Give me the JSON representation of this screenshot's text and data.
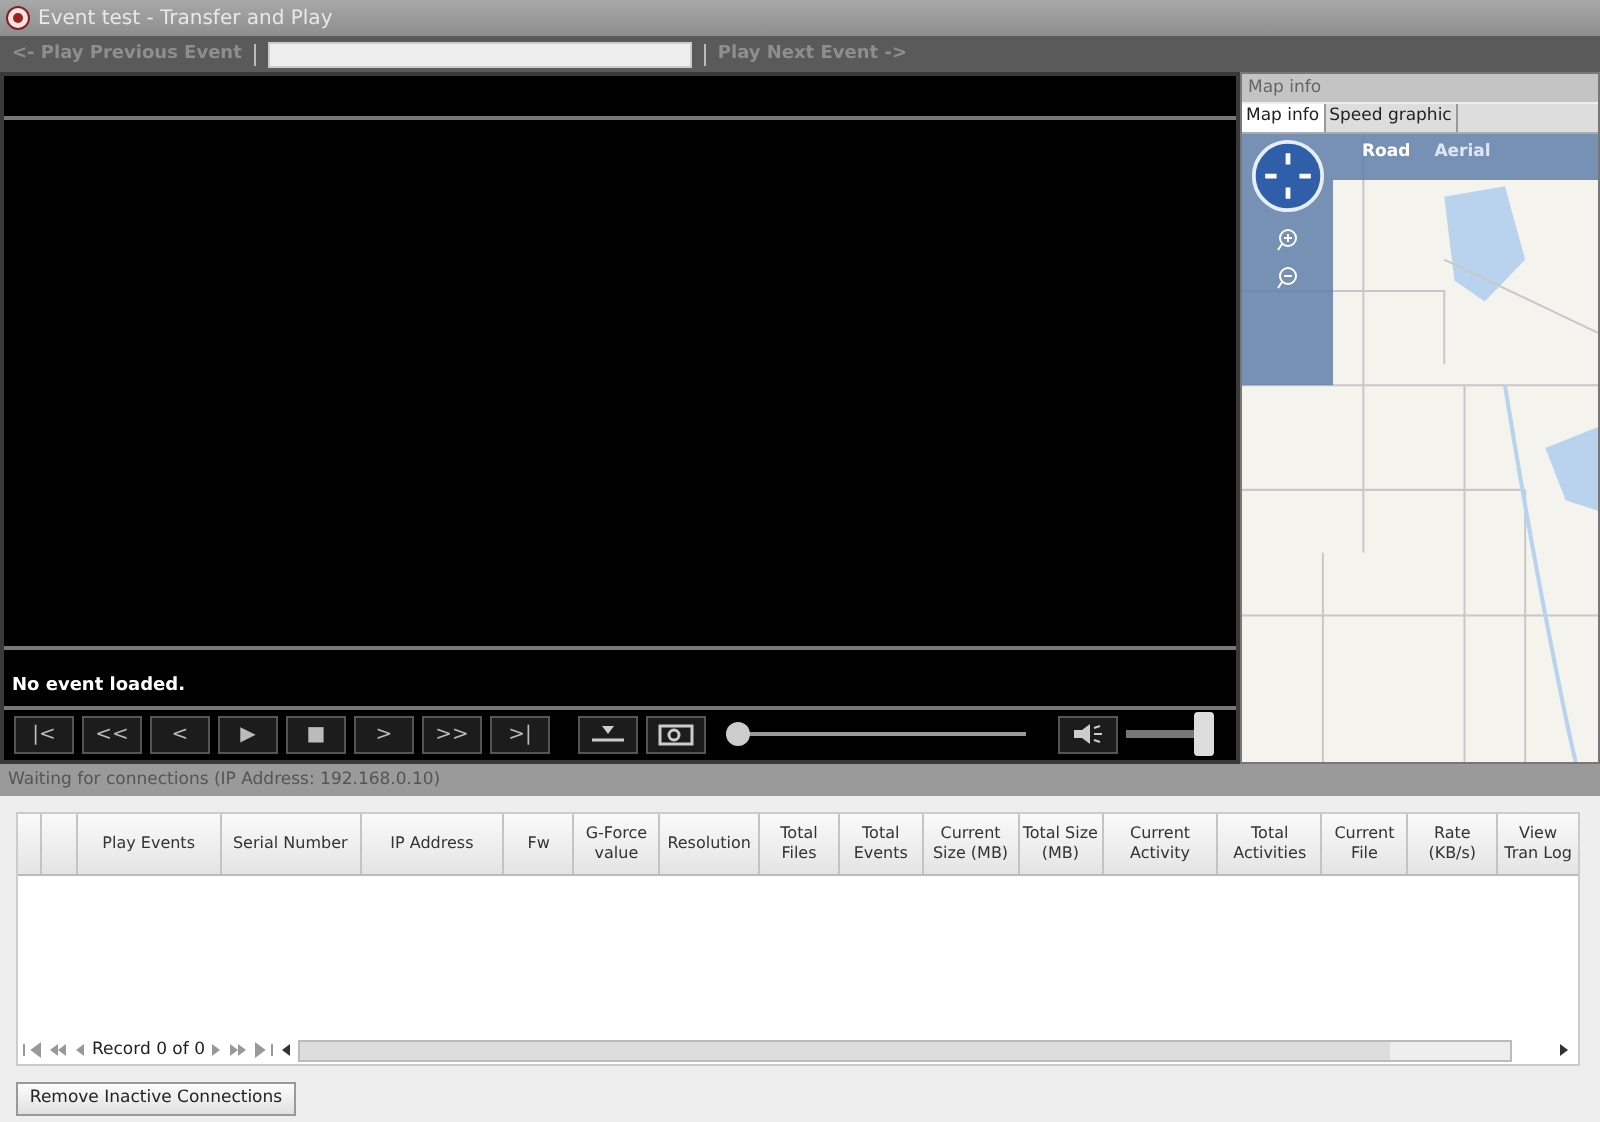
{
  "window": {
    "title": "Event test - Transfer and Play"
  },
  "event_nav": {
    "previous": "<- Play Previous Event",
    "next": "Play Next Event ->"
  },
  "player": {
    "status": "No event loaded.",
    "controls": [
      {
        "label": "|<"
      },
      {
        "label": "<<"
      },
      {
        "label": "<"
      },
      {
        "label": "▶"
      },
      {
        "label": "■"
      },
      {
        "label": ">"
      },
      {
        "label": ">>"
      },
      {
        "label": ">|"
      }
    ],
    "position": {
      "level": 0
    },
    "volume": {
      "level": 1
    }
  },
  "map_panel": {
    "title": "Map info",
    "tabs": [
      {
        "label": "Map info",
        "selected": true
      },
      {
        "label": "Speed graphic",
        "selected": false
      }
    ],
    "map_modes": [
      {
        "label": "Road",
        "selected": true
      },
      {
        "label": "Aerial",
        "selected": false
      }
    ]
  },
  "connections": {
    "status": "Waiting for connections (IP Address: 192.168.0.10)",
    "table": {
      "columns": [
        "",
        "",
        "Play Events",
        "Serial Number",
        "IP Address",
        "Fw",
        "G-Force value",
        "Resolution",
        "Total Files",
        "Total Events",
        "Current Size (MB)",
        "Total Size (MB)",
        "Current Activity",
        "Total Activities",
        "Current File",
        "Rate (KB/s)",
        "View Tran Log"
      ]
    },
    "record_label": "Record 0 of 0",
    "button": "Remove Inactive Connections"
  }
}
